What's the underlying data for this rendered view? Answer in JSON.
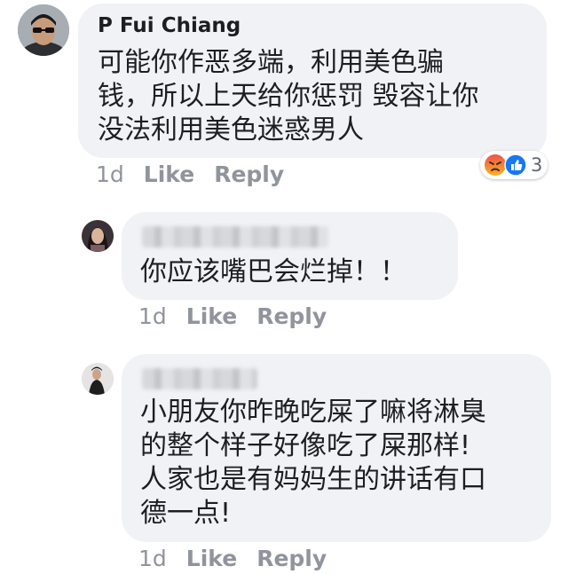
{
  "comments": [
    {
      "author": "P Fui Chiang",
      "lines": [
        "可能你作恶多端，利用美色骗",
        "钱，所以上天给你惩罚 毁容让你",
        "没法利用美色迷惑男人"
      ],
      "time": "1d",
      "like": "Like",
      "reply": "Reply",
      "reactions": {
        "icons": [
          "angry-icon",
          "like-icon"
        ],
        "count": "3"
      }
    },
    {
      "author_redacted": true,
      "lines": [
        "你应该嘴巴会烂掉！！"
      ],
      "time": "1d",
      "like": "Like",
      "reply": "Reply"
    },
    {
      "author_redacted": true,
      "lines": [
        "小朋友你昨晚吃屎了嘛将淋臭",
        "的整个样子好像吃了屎那样!",
        "人家也是有妈妈生的讲话有口",
        "德一点!"
      ],
      "time": "1d",
      "like": "Like",
      "reply": "Reply"
    }
  ],
  "colors": {
    "bubble": "#f1f2f6",
    "meta": "#90949c",
    "angry": "#f0534a",
    "like": "#1877f2"
  }
}
